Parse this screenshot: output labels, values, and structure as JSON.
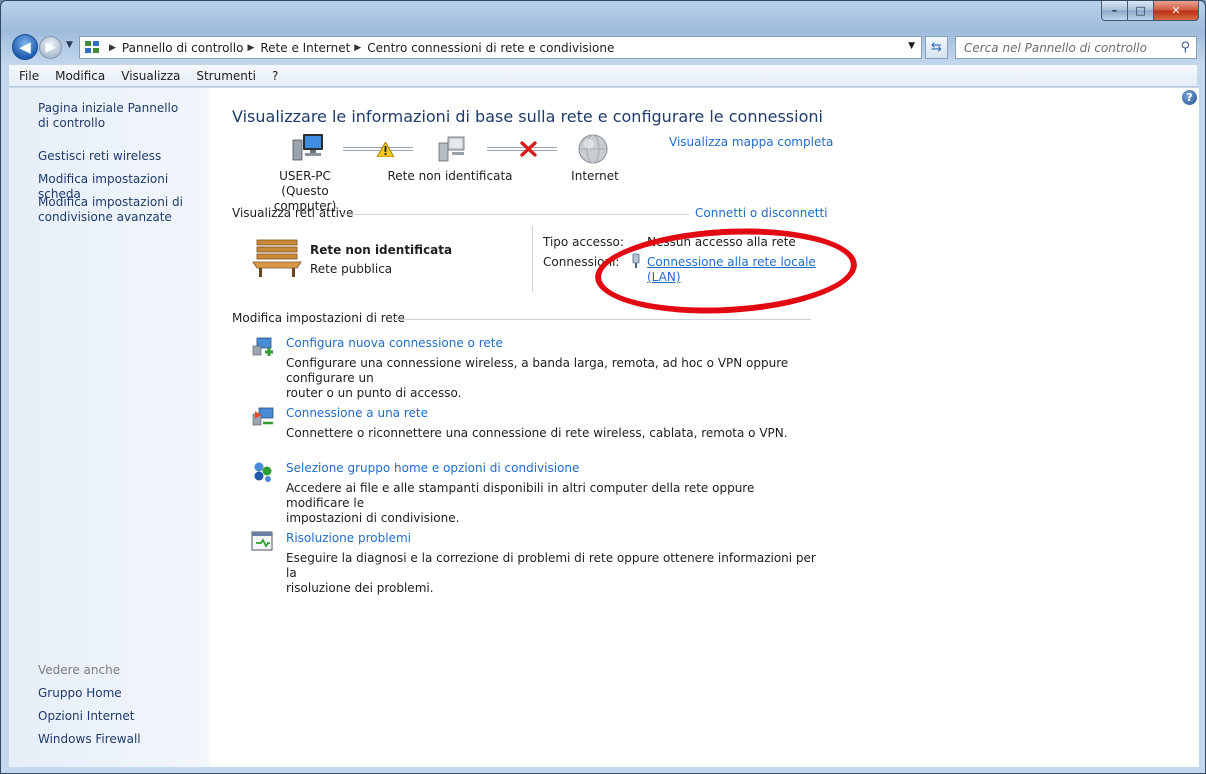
{
  "window": {
    "caption": {
      "minimize": "–",
      "maximize": "□",
      "close": "✕"
    }
  },
  "address": {
    "crumbs": [
      "Pannello di controllo",
      "Rete e Internet",
      "Centro connessioni di rete e condivisione"
    ],
    "search_placeholder": "Cerca nel Pannello di controllo"
  },
  "menu": [
    "File",
    "Modifica",
    "Visualizza",
    "Strumenti",
    "?"
  ],
  "sidebar": {
    "links": [
      "Pagina iniziale Pannello di controllo",
      "Gestisci reti wireless",
      "Modifica impostazioni scheda",
      "Modifica impostazioni di condivisione avanzate"
    ],
    "see_also_heading": "Vedere anche",
    "see_also": [
      "Gruppo Home",
      "Opzioni Internet",
      "Windows Firewall"
    ]
  },
  "main": {
    "title": "Visualizzare le informazioni di base sulla rete e configurare le connessioni",
    "full_map_link": "Visualizza mappa completa",
    "map": {
      "computer_name": "USER-PC",
      "computer_sub": "(Questo computer)",
      "network_name": "Rete non identificata",
      "internet_name": "Internet"
    },
    "active": {
      "heading": "Visualizza reti attive",
      "connect_link": "Connetti o disconnetti",
      "network_name": "Rete non identificata",
      "network_type": "Rete pubblica",
      "access_label": "Tipo accesso:",
      "access_value": "Nessun accesso alla rete",
      "connections_label": "Connessioni:",
      "connection_link_line1": "Connessione alla rete locale",
      "connection_link_line2": "(LAN)"
    },
    "settings": {
      "heading": "Modifica impostazioni di rete",
      "tasks": [
        {
          "title": "Configura nuova connessione o rete",
          "desc1": "Configurare una connessione wireless, a banda larga, remota, ad hoc o VPN oppure configurare un",
          "desc2": "router o un punto di accesso."
        },
        {
          "title": "Connessione a una rete",
          "desc1": "Connettere o riconnettere una connessione di rete wireless, cablata, remota o VPN.",
          "desc2": ""
        },
        {
          "title": "Selezione gruppo home e opzioni di condivisione",
          "desc1": "Accedere ai file e alle stampanti disponibili in altri computer della rete oppure modificare le",
          "desc2": "impostazioni di condivisione."
        },
        {
          "title": "Risoluzione problemi",
          "desc1": "Eseguire la diagnosi e la correzione di problemi di rete oppure ottenere informazioni per la",
          "desc2": "risoluzione dei problemi."
        }
      ]
    }
  },
  "icons": {
    "warning": "warning-icon",
    "error": "red-x-icon",
    "help": "?"
  },
  "colors": {
    "link": "#1f6cc7",
    "title": "#1e3c6b",
    "annotation": "#e20912"
  }
}
